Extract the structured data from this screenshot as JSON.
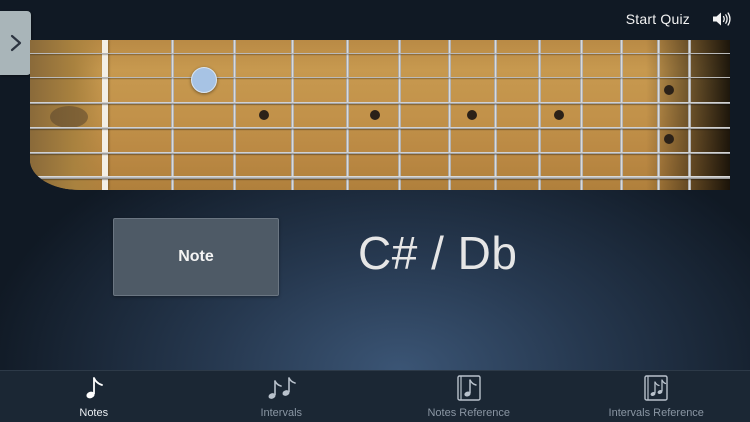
{
  "header": {
    "start_quiz_label": "Start Quiz"
  },
  "fretboard": {
    "selected_string": 2,
    "selected_fret": 2
  },
  "main": {
    "mode_button_label": "Note",
    "note_display": "C# / Db"
  },
  "tabs": [
    {
      "label": "Notes",
      "icon": "note-icon",
      "active": true
    },
    {
      "label": "Intervals",
      "icon": "notes-pair-icon",
      "active": false
    },
    {
      "label": "Notes Reference",
      "icon": "note-book-icon",
      "active": false
    },
    {
      "label": "Intervals Reference",
      "icon": "notes-pair-book-icon",
      "active": false
    }
  ]
}
